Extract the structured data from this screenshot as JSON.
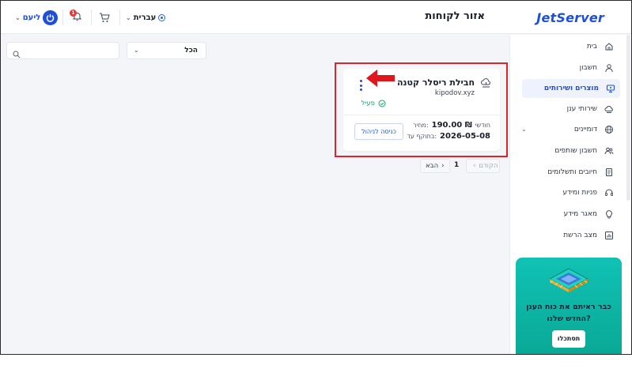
{
  "header": {
    "logo": "JetServer",
    "title": "אזור לקוחות",
    "language": "עברית",
    "notifications_count": "1",
    "user_name": "ליעם"
  },
  "sidebar": {
    "items": [
      {
        "label": "בית",
        "icon": "home-icon"
      },
      {
        "label": "חשבון",
        "icon": "user-icon"
      },
      {
        "label": "מוצרים ושירותים",
        "icon": "server-icon",
        "active": true
      },
      {
        "label": "שירותי ענן",
        "icon": "cloud-icon"
      },
      {
        "label": "דומיינים",
        "icon": "globe-icon",
        "expandable": true
      },
      {
        "label": "חשבון שותפים",
        "icon": "users-icon"
      },
      {
        "label": "חיובים ותשלומים",
        "icon": "invoice-icon"
      },
      {
        "label": "פניות ומידע",
        "icon": "headset-icon"
      },
      {
        "label": "מאגר מידע",
        "icon": "lightbulb-icon"
      },
      {
        "label": "מצב הרשת",
        "icon": "chart-icon"
      }
    ]
  },
  "promo": {
    "text": "כבר ראיתם את כוח הענן החדש שלנו?",
    "button": "תסתכלו"
  },
  "filters": {
    "select_value": "הכל",
    "search_placeholder": ""
  },
  "card": {
    "title": "חבילת ריסלר קטנה",
    "domain": "kipodov.xyz",
    "status": "פעיל",
    "price_label": "מחיר:",
    "price": "190.00 ₪",
    "period": "חודשי",
    "valid_label": "בתוקף עד:",
    "valid_until": "2026-05-08",
    "manage_button": "כניסה לניהול"
  },
  "pagination": {
    "prev": "הקודם",
    "page": "1",
    "next": "הבא"
  },
  "colors": {
    "accent": "#1f4fd8",
    "status_ok": "#1ba56b",
    "highlight": "#e0232a",
    "promo": "#10c2b4"
  }
}
